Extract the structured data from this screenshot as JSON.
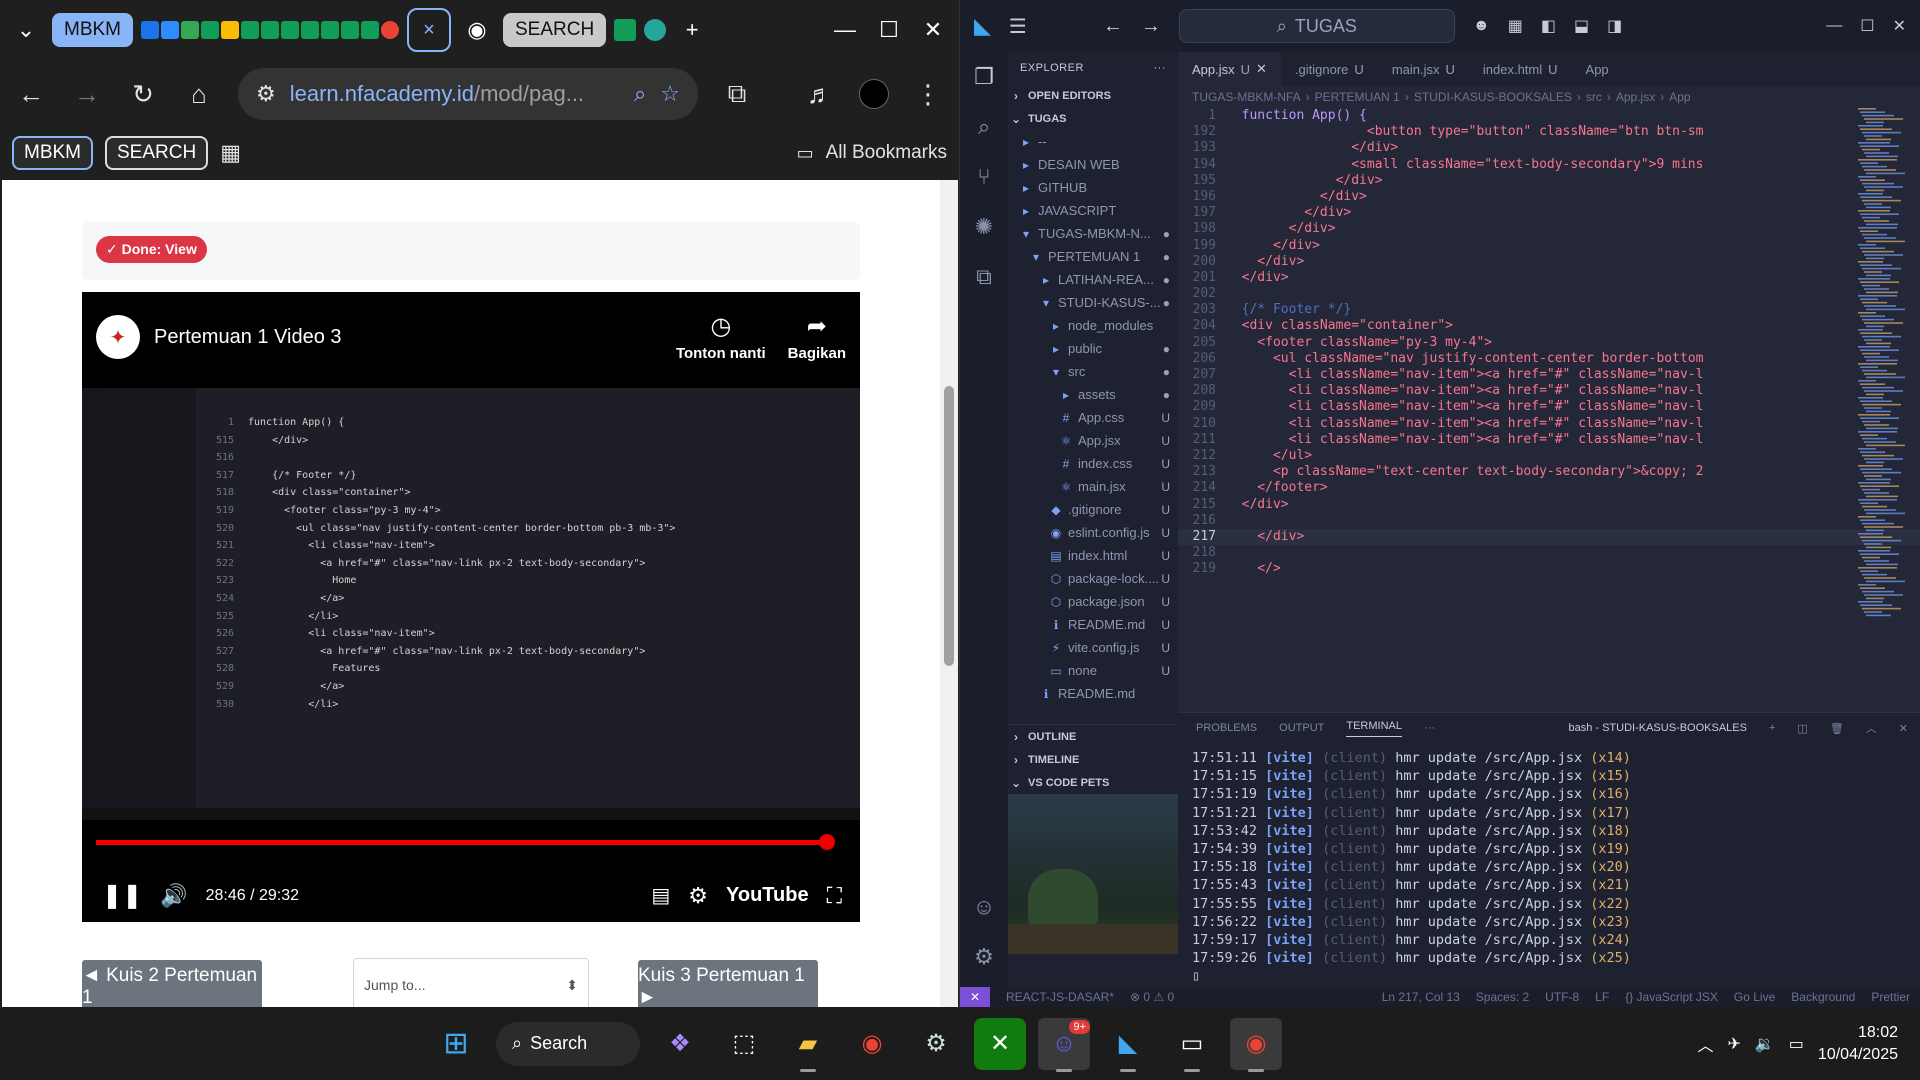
{
  "chrome": {
    "tabs": {
      "group1": "MBKM",
      "group2": "SEARCH",
      "close": "×",
      "newtab": "+"
    },
    "url_host": "learn.nfacademy.id",
    "url_path": "/mod/pag...",
    "bookmarks": {
      "mbkm": "MBKM",
      "search": "SEARCH",
      "all": "All Bookmarks"
    },
    "page": {
      "done_badge": "Done: View",
      "video": {
        "title": "Pertemuan 1 Video 3",
        "watch_later": "Tonton nanti",
        "share": "Bagikan",
        "time": "28:46 / 29:32",
        "brand": "YouTube",
        "progress": 0.975,
        "code_lines": [
          {
            "n": "1",
            "t": "function App() {"
          },
          {
            "n": "515",
            "t": "    </div>"
          },
          {
            "n": "516",
            "t": ""
          },
          {
            "n": "517",
            "t": "    {/* Footer */}"
          },
          {
            "n": "518",
            "t": "    <div class=\"container\">"
          },
          {
            "n": "519",
            "t": "      <footer class=\"py-3 my-4\">"
          },
          {
            "n": "520",
            "t": "        <ul class=\"nav justify-content-center border-bottom pb-3 mb-3\">"
          },
          {
            "n": "521",
            "t": "          <li class=\"nav-item\">"
          },
          {
            "n": "522",
            "t": "            <a href=\"#\" class=\"nav-link px-2 text-body-secondary\">"
          },
          {
            "n": "523",
            "t": "              Home"
          },
          {
            "n": "524",
            "t": "            </a>"
          },
          {
            "n": "525",
            "t": "          </li>"
          },
          {
            "n": "526",
            "t": "          <li class=\"nav-item\">"
          },
          {
            "n": "527",
            "t": "            <a href=\"#\" class=\"nav-link px-2 text-body-secondary\">"
          },
          {
            "n": "528",
            "t": "              Features"
          },
          {
            "n": "529",
            "t": "            </a>"
          },
          {
            "n": "530",
            "t": "          </li>"
          }
        ]
      },
      "prev_button": "◄ Kuis 2 Pertemuan 1",
      "jump_placeholder": "Jump to...",
      "next_button": "Kuis 3 Pertemuan 1 ►"
    }
  },
  "vscode": {
    "search": "TUGAS",
    "explorer": "EXPLORER",
    "open_editors": "OPEN EDITORS",
    "root": "TUGAS",
    "tree": [
      {
        "label": "--",
        "icon": "▸",
        "depth": 1,
        "status": ""
      },
      {
        "label": "DESAIN WEB",
        "icon": "▸",
        "depth": 1,
        "status": ""
      },
      {
        "label": "GITHUB",
        "icon": "▸",
        "depth": 1,
        "status": ""
      },
      {
        "label": "JAVASCRIPT",
        "icon": "▸",
        "depth": 1,
        "status": ""
      },
      {
        "label": "TUGAS-MBKM-N...",
        "icon": "▾",
        "depth": 1,
        "status": "●"
      },
      {
        "label": "PERTEMUAN 1",
        "icon": "▾",
        "depth": 2,
        "status": "●"
      },
      {
        "label": "LATIHAN-REA...",
        "icon": "▸",
        "depth": 3,
        "status": "●"
      },
      {
        "label": "STUDI-KASUS-...",
        "icon": "▾",
        "depth": 3,
        "status": "●"
      },
      {
        "label": "node_modules",
        "icon": "▸",
        "depth": 4,
        "status": ""
      },
      {
        "label": "public",
        "icon": "▸",
        "depth": 4,
        "status": "●"
      },
      {
        "label": "src",
        "icon": "▾",
        "depth": 4,
        "status": "●"
      },
      {
        "label": "assets",
        "icon": "▸",
        "depth": 5,
        "status": "●"
      },
      {
        "label": "App.css",
        "icon": "#",
        "depth": 5,
        "status": "U"
      },
      {
        "label": "App.jsx",
        "icon": "⚛",
        "depth": 5,
        "status": "U"
      },
      {
        "label": "index.css",
        "icon": "#",
        "depth": 5,
        "status": "U"
      },
      {
        "label": "main.jsx",
        "icon": "⚛",
        "depth": 5,
        "status": "U"
      },
      {
        "label": ".gitignore",
        "icon": "◆",
        "depth": 4,
        "status": "U"
      },
      {
        "label": "eslint.config.js",
        "icon": "◉",
        "depth": 4,
        "status": "U"
      },
      {
        "label": "index.html",
        "icon": "▤",
        "depth": 4,
        "status": "U"
      },
      {
        "label": "package-lock....",
        "icon": "⬡",
        "depth": 4,
        "status": "U"
      },
      {
        "label": "package.json",
        "icon": "⬡",
        "depth": 4,
        "status": "U"
      },
      {
        "label": "README.md",
        "icon": "ℹ",
        "depth": 4,
        "status": "U"
      },
      {
        "label": "vite.config.js",
        "icon": "⚡",
        "depth": 4,
        "status": "U"
      },
      {
        "label": "none",
        "icon": "▭",
        "depth": 4,
        "status": "U"
      },
      {
        "label": "README.md",
        "icon": "ℹ",
        "depth": 3,
        "status": ""
      }
    ],
    "outline": "OUTLINE",
    "timeline": "TIMELINE",
    "pets": "VS CODE PETS",
    "tabs": [
      {
        "label": "App.jsx",
        "status": "U",
        "active": true
      },
      {
        "label": ".gitignore",
        "status": "U",
        "active": false
      },
      {
        "label": "main.jsx",
        "status": "U",
        "active": false
      },
      {
        "label": "index.html",
        "status": "U",
        "active": false
      },
      {
        "label": "App",
        "status": "",
        "active": false
      }
    ],
    "breadcrumbs": [
      "TUGAS-MBKM-NFA",
      "PERTEMUAN 1",
      "STUDI-KASUS-BOOKSALES",
      "src",
      "App.jsx",
      "App"
    ],
    "sticky_line": {
      "n": "1",
      "t": "function App() {"
    },
    "code": [
      {
        "n": "192",
        "t": "                <button type=\"button\" className=\"btn btn-sm"
      },
      {
        "n": "193",
        "t": "              </div>"
      },
      {
        "n": "194",
        "t": "              <small className=\"text-body-secondary\">9 mins"
      },
      {
        "n": "195",
        "t": "            </div>"
      },
      {
        "n": "196",
        "t": "          </div>"
      },
      {
        "n": "197",
        "t": "        </div>"
      },
      {
        "n": "198",
        "t": "      </div>"
      },
      {
        "n": "199",
        "t": "    </div>"
      },
      {
        "n": "200",
        "t": "  </div>"
      },
      {
        "n": "201",
        "t": "</div>"
      },
      {
        "n": "202",
        "t": ""
      },
      {
        "n": "203",
        "t": "{/* Footer */}"
      },
      {
        "n": "204",
        "t": "<div className=\"container\">"
      },
      {
        "n": "205",
        "t": "  <footer className=\"py-3 my-4\">"
      },
      {
        "n": "206",
        "t": "    <ul className=\"nav justify-content-center border-bottom"
      },
      {
        "n": "207",
        "t": "      <li className=\"nav-item\"><a href=\"#\" className=\"nav-l"
      },
      {
        "n": "208",
        "t": "      <li className=\"nav-item\"><a href=\"#\" className=\"nav-l"
      },
      {
        "n": "209",
        "t": "      <li className=\"nav-item\"><a href=\"#\" className=\"nav-l"
      },
      {
        "n": "210",
        "t": "      <li className=\"nav-item\"><a href=\"#\" className=\"nav-l"
      },
      {
        "n": "211",
        "t": "      <li className=\"nav-item\"><a href=\"#\" className=\"nav-l"
      },
      {
        "n": "212",
        "t": "    </ul>"
      },
      {
        "n": "213",
        "t": "    <p className=\"text-center text-body-secondary\">&copy; 2"
      },
      {
        "n": "214",
        "t": "  </footer>"
      },
      {
        "n": "215",
        "t": "</div>"
      },
      {
        "n": "216",
        "t": ""
      },
      {
        "n": "217",
        "t": "  </div>"
      },
      {
        "n": "218",
        "t": ""
      },
      {
        "n": "219",
        "t": "  </>"
      }
    ],
    "panel": {
      "tabs": [
        "PROBLEMS",
        "OUTPUT",
        "TERMINAL"
      ],
      "more": "···",
      "terminal_name": "bash - STUDI-KASUS-BOOKSALES",
      "lines": [
        {
          "time": "17:51:11",
          "count": "(x14)"
        },
        {
          "time": "17:51:15",
          "count": "(x15)"
        },
        {
          "time": "17:51:19",
          "count": "(x16)"
        },
        {
          "time": "17:51:21",
          "count": "(x17)"
        },
        {
          "time": "17:53:42",
          "count": "(x18)"
        },
        {
          "time": "17:54:39",
          "count": "(x19)"
        },
        {
          "time": "17:55:18",
          "count": "(x20)"
        },
        {
          "time": "17:55:43",
          "count": "(x21)"
        },
        {
          "time": "17:55:55",
          "count": "(x22)"
        },
        {
          "time": "17:56:22",
          "count": "(x23)"
        },
        {
          "time": "17:59:17",
          "count": "(x24)"
        },
        {
          "time": "17:59:26",
          "count": "(x25)"
        }
      ],
      "tag": "[vite]",
      "client": "(client)",
      "msg": "hmr update /src/App.jsx"
    },
    "status": [
      "REACT-JS-DASAR*",
      "⊗ 0 ⚠ 0",
      "Ln 217, Col 13",
      "Spaces: 2",
      "UTF-8",
      "LF",
      "{} JavaScript JSX",
      "Go Live",
      "Background",
      "Prettier"
    ]
  },
  "taskbar": {
    "search": "Search",
    "time": "18:02",
    "date": "10/04/2025",
    "discord_badge": "9+"
  }
}
